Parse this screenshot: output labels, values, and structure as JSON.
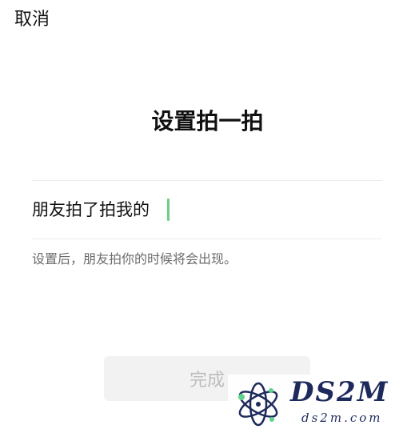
{
  "header": {
    "cancel_label": "取消"
  },
  "main": {
    "title": "设置拍一拍",
    "input": {
      "prefix": "朋友拍了拍我的",
      "value": "",
      "caret_color": "#6fcf87"
    },
    "hint": "设置后，朋友拍你的时候将会出现。",
    "done_label": "完成",
    "done_enabled": false
  },
  "watermark": {
    "brand": "DS2M",
    "domain": "ds2m.com",
    "icon": "atom-logo-icon"
  },
  "colors": {
    "background": "#ffffff",
    "text": "#111111",
    "hint_text": "#6b6b6b",
    "divider": "#ececec",
    "button_disabled_bg": "#f2f2f2",
    "button_disabled_text": "#bdbdbd",
    "accent": "#6fcf87"
  }
}
